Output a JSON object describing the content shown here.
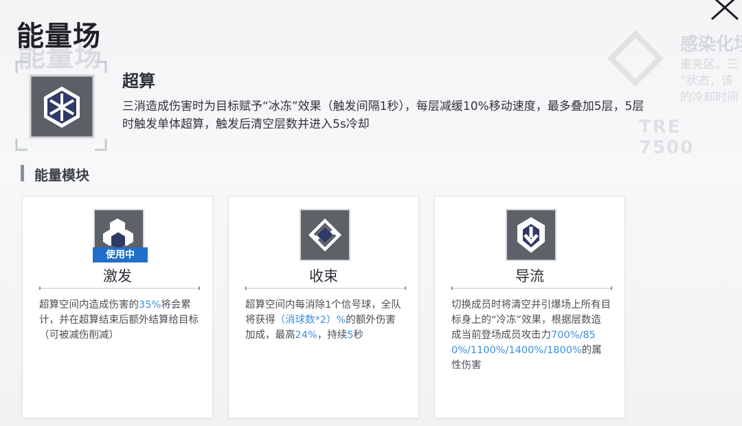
{
  "header": {
    "title": "能量场"
  },
  "skill": {
    "name": "超算",
    "description": "三消造成伤害时为目标赋予“冰冻”效果（触发间隔1秒），每层减缓10%移动速度，最多叠加5层，5层时触发单体超算，触发后清空层数并进入5s冷却"
  },
  "section": {
    "title": "能量模块"
  },
  "background": {
    "title": "感染化场",
    "text": "重夹区，三\n“状态，该\n的冷却时间",
    "number": "TRE 7500"
  },
  "modules": [
    {
      "name": "激发",
      "badge": "使用中",
      "desc": [
        {
          "t": "超算空间内造成伤害的"
        },
        {
          "t": "35%",
          "hl": true
        },
        {
          "t": "将会累计，并在超算结束后额外结算给目标（可被减伤削减）"
        }
      ]
    },
    {
      "name": "收束",
      "desc": [
        {
          "t": "超算空间内每消除1个信号球，全队将获得"
        },
        {
          "t": "（消球数*2）%",
          "hl": true
        },
        {
          "t": "的额外伤害加成，最高"
        },
        {
          "t": "24%",
          "hl": true
        },
        {
          "t": "，持续"
        },
        {
          "t": "5",
          "hl": true
        },
        {
          "t": "秒"
        }
      ]
    },
    {
      "name": "导流",
      "desc": [
        {
          "t": "切换成员时将清空并引爆场上所有目标身上的“冷冻”效果，根据层数造成当前登场成员攻击力"
        },
        {
          "t": "700%/850%/1100%/1400%/1800%",
          "hl": true
        },
        {
          "t": "的属性伤害"
        }
      ]
    }
  ],
  "colors": {
    "accent": "#3b8fe0",
    "badge": "#1f6fcb",
    "icon_bg": "#5d6168"
  },
  "icons": {
    "close": "close-icon",
    "skill": "snowflake-hex-icon",
    "modules": [
      "cubes-icon",
      "interlock-diamond-icon",
      "arrow-down-shield-icon"
    ]
  }
}
